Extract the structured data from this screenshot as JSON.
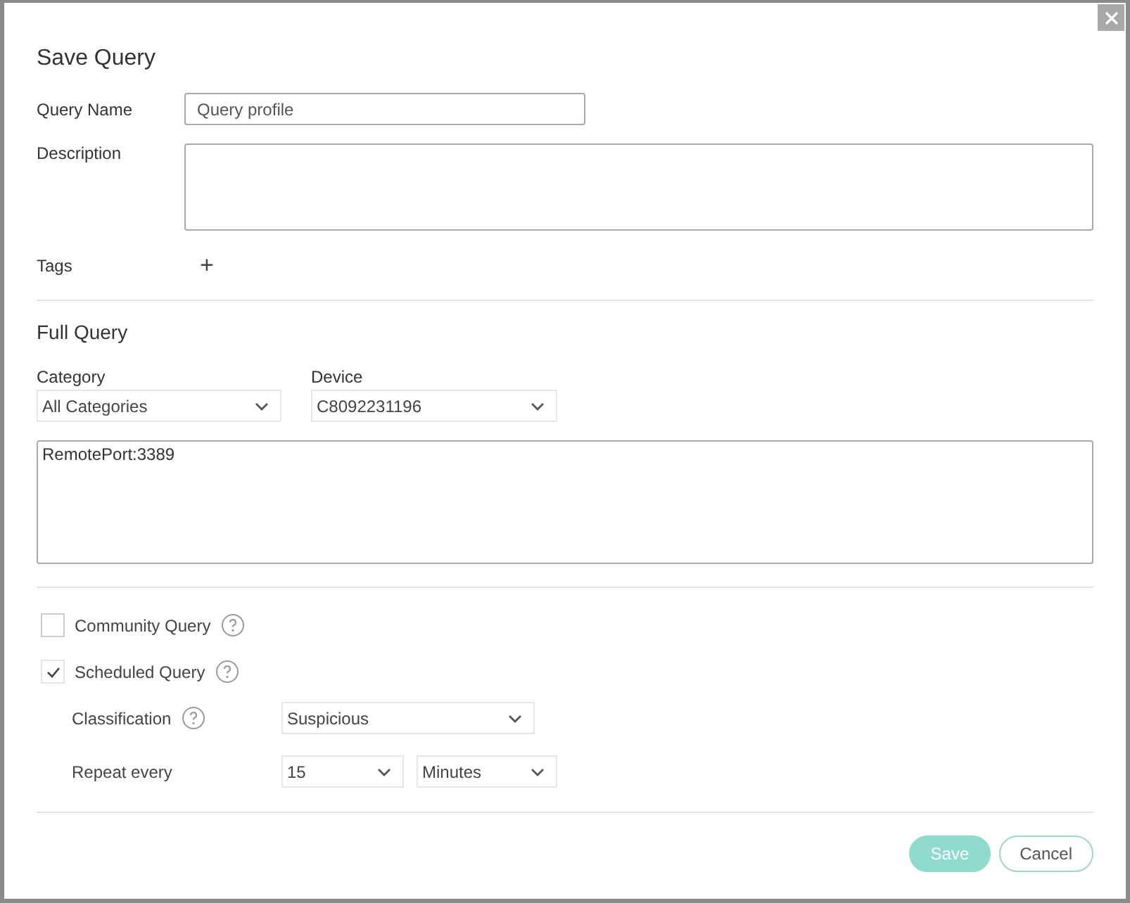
{
  "dialog": {
    "title": "Save Query"
  },
  "query_name": {
    "label": "Query Name",
    "value": "Query profile"
  },
  "description": {
    "label": "Description"
  },
  "tags": {
    "label": "Tags",
    "add": "+"
  },
  "full_query": {
    "heading": "Full Query",
    "category": {
      "label": "Category",
      "value": "All Categories"
    },
    "device": {
      "label": "Device",
      "value": "C8092231196"
    },
    "query_text": "RemotePort:3389"
  },
  "options": [
    {
      "label": "Community Query",
      "checked": false
    },
    {
      "label": "Scheduled Query",
      "checked": true
    }
  ],
  "classification": {
    "label": "Classification",
    "value": "Suspicious"
  },
  "repeat_every": {
    "label": "Repeat every",
    "count": "15",
    "unit": "Minutes"
  },
  "buttons": [
    {
      "label": "Save",
      "kind": "primary",
      "disabled": true
    },
    {
      "label": "Cancel",
      "kind": "secondary",
      "disabled": false
    }
  ]
}
